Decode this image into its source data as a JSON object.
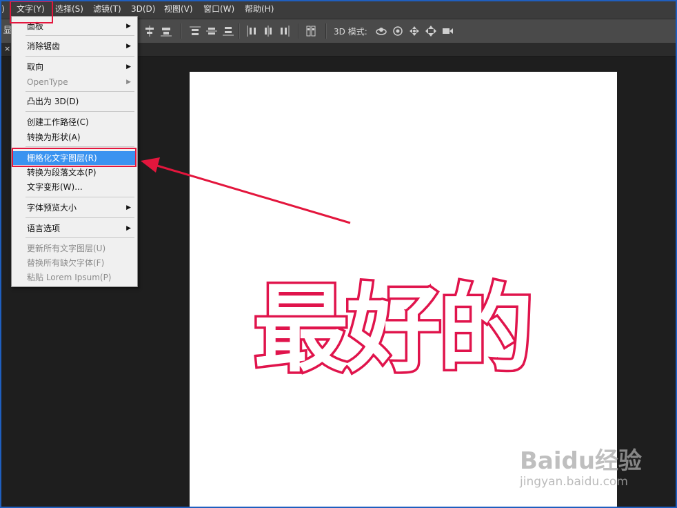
{
  "menubar": {
    "items": [
      {
        "label": ")"
      },
      {
        "label": "文字(Y)"
      },
      {
        "label": "选择(S)"
      },
      {
        "label": "滤镜(T)"
      },
      {
        "label": "3D(D)"
      },
      {
        "label": "视图(V)"
      },
      {
        "label": "窗口(W)"
      },
      {
        "label": "帮助(H)"
      }
    ]
  },
  "optionsbar": {
    "left_glyph": "显",
    "mode_label": "3D 模式:"
  },
  "tab": {
    "close_glyph": "×"
  },
  "dropdown": {
    "items": [
      {
        "label": "面板",
        "submenu": true
      },
      {
        "label": "消除锯齿",
        "submenu": true
      },
      {
        "label": "取向",
        "submenu": true
      },
      {
        "label": "OpenType",
        "submenu": true,
        "disabled": true
      },
      {
        "label": "凸出为 3D(D)"
      },
      {
        "label": "创建工作路径(C)"
      },
      {
        "label": "转换为形状(A)"
      },
      {
        "label": "栅格化文字图层(R)",
        "highlighted": true
      },
      {
        "label": "转换为段落文本(P)"
      },
      {
        "label": "文字变形(W)..."
      },
      {
        "label": "字体预览大小",
        "submenu": true
      },
      {
        "label": "语言选项",
        "submenu": true
      },
      {
        "label": "更新所有文字图层(U)",
        "disabled": true
      },
      {
        "label": "替换所有缺欠字体(F)",
        "disabled": true
      },
      {
        "label": "粘贴 Lorem Ipsum(P)",
        "disabled": true
      }
    ],
    "arrow_glyph": "▶"
  },
  "canvas": {
    "text": "最好的"
  },
  "watermark": {
    "main": "Baidu经验",
    "sub": "jingyan.baidu.com"
  },
  "colors": {
    "highlight": "#3a93f0",
    "annotation_red": "#e3163d",
    "text_stroke": "#e0144c"
  }
}
